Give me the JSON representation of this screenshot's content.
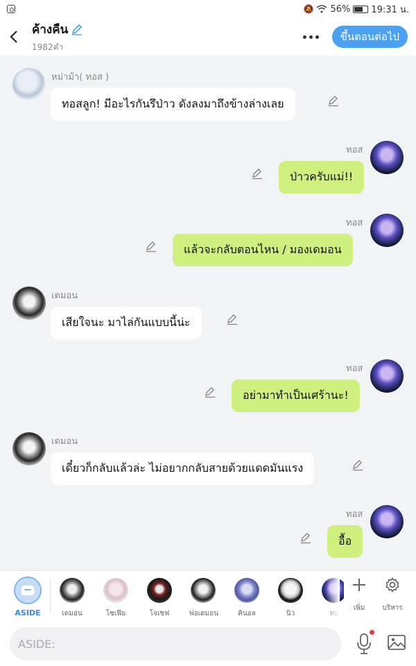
{
  "status_bar": {
    "battery_percent": "56%",
    "time": "19:31 น."
  },
  "header": {
    "title": "ค้างคืน",
    "subtitle": "1982คำ",
    "next_button": "ขึ้นตอนต่อไป"
  },
  "messages": [
    {
      "side": "left",
      "speaker": "หม่าม้า( ทอส )",
      "text": "ทอสลูก! มีอะไรกันรึป่าว ดังลงมาถึงข้างล่างเลย"
    },
    {
      "side": "right",
      "speaker": "ทอส",
      "text": "ป่าวครับแม่!!"
    },
    {
      "side": "right",
      "speaker": "ทอส",
      "text": "แล้วจะกลับตอนไหน / มองเดมอน"
    },
    {
      "side": "left",
      "speaker": "เดมอน",
      "text": "เสียใจนะ มาไล่กันแบบนี้น่ะ"
    },
    {
      "side": "right",
      "speaker": "ทอส",
      "text": "อย่ามาทำเป็นเศร้านะ!"
    },
    {
      "side": "left",
      "speaker": "เดมอน",
      "text": "เดี๋ยวก็กลับแล้วล่ะ ไม่อยากกลับสายด้วยแดดมันแรง"
    },
    {
      "side": "right",
      "speaker": "ทอส",
      "text": "อื้อ"
    }
  ],
  "character_bar": {
    "aside_label": "ASIDE",
    "characters": [
      "เดมอน",
      "โซเฟีย",
      "โจเซฟ",
      "พ่อเดมอน",
      "คินอล",
      "นิว",
      "ทอ"
    ],
    "add_label": "เพิ่ม",
    "manage_label": "บริหาร"
  },
  "input": {
    "placeholder": "ASIDE:",
    "value": ""
  },
  "colors": {
    "accent": "#4aa0f2",
    "my_bubble": "#cdf07e",
    "background": "#f2f3f5"
  },
  "icons": [
    "instagram-icon",
    "mute-icon",
    "wifi-icon",
    "battery-icon",
    "back-icon",
    "pencil-icon",
    "more-icon",
    "edit-icon",
    "aside-icon",
    "plus-icon",
    "gear-icon",
    "mic-icon",
    "image-icon"
  ]
}
